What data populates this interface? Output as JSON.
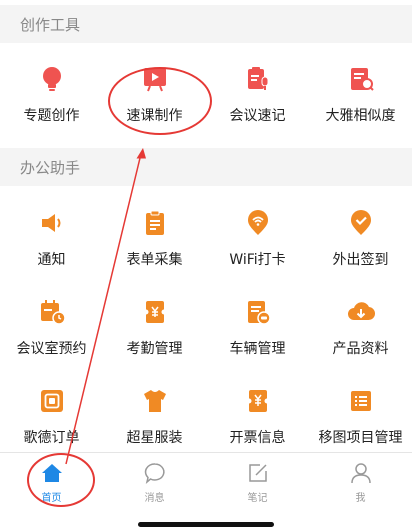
{
  "sections": {
    "creation_tools": {
      "title": "创作工具",
      "items": [
        {
          "label": "专题创作",
          "icon": "lightbulb-icon"
        },
        {
          "label": "速课制作",
          "icon": "video-play-icon"
        },
        {
          "label": "会议速记",
          "icon": "meeting-notes-mic-icon"
        },
        {
          "label": "大雅相似度",
          "icon": "document-search-icon"
        }
      ]
    },
    "office_assistant": {
      "title": "办公助手",
      "items": [
        {
          "label": "通知",
          "icon": "megaphone-icon"
        },
        {
          "label": "表单采集",
          "icon": "clipboard-form-icon"
        },
        {
          "label": "WiFi打卡",
          "icon": "wifi-checkin-icon"
        },
        {
          "label": "外出签到",
          "icon": "location-check-icon"
        },
        {
          "label": "会议室预约",
          "icon": "calendar-clock-icon"
        },
        {
          "label": "考勤管理",
          "icon": "attendance-ticket-icon"
        },
        {
          "label": "车辆管理",
          "icon": "car-document-icon"
        },
        {
          "label": "产品资料",
          "icon": "cloud-download-icon"
        },
        {
          "label": "歌德订单",
          "icon": "order-square-icon"
        },
        {
          "label": "超星服装",
          "icon": "tshirt-icon"
        },
        {
          "label": "开票信息",
          "icon": "invoice-yen-icon"
        },
        {
          "label": "移图项目管理",
          "icon": "project-list-icon"
        }
      ]
    }
  },
  "tabbar": {
    "tabs": [
      {
        "label": "首页",
        "icon": "home-icon",
        "active": true
      },
      {
        "label": "消息",
        "icon": "chat-bubble-icon",
        "active": false
      },
      {
        "label": "笔记",
        "icon": "note-edit-icon",
        "active": false
      },
      {
        "label": "我",
        "icon": "person-icon",
        "active": false
      }
    ]
  },
  "colors": {
    "accent_orange": "#f08a24",
    "accent_red": "#ef5350",
    "active_blue": "#1e88e5",
    "annotation_red": "#e53935",
    "section_bg": "#f4f4f4"
  }
}
